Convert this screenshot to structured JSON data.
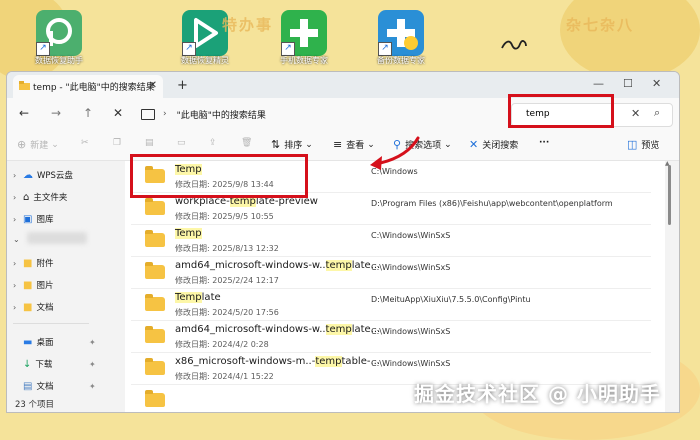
{
  "desktop": {
    "icons": [
      {
        "label": "数据恢复助手",
        "color": "#4caf6e"
      },
      {
        "label": "数据恢复精灵",
        "color": "#1ba178"
      },
      {
        "label": "手机数据专家",
        "color": "#2fb24c"
      },
      {
        "label": "备份数据专家",
        "color": "#2a8fd6"
      }
    ],
    "faded_texts": [
      "特办事",
      "杂七杂八"
    ]
  },
  "window": {
    "tab_title": "temp - \"此电脑\"中的搜索结果",
    "address_text": "\"此电脑\"中的搜索结果",
    "search_value": "temp",
    "toolbar": {
      "new": "新建",
      "sort": "排序",
      "view": "查看",
      "search_options": "搜索选项",
      "close_search": "关闭搜索",
      "more": "···",
      "preview": "预览"
    },
    "sidebar": {
      "items": [
        {
          "label": "WPS云盘",
          "icon": "cloud-icon"
        },
        {
          "label": "主文件夹",
          "icon": "home-icon"
        },
        {
          "label": "图库",
          "icon": "gallery-icon"
        },
        {
          "label": "附件",
          "icon": "folder-icon"
        },
        {
          "label": "图片",
          "icon": "folder-icon"
        },
        {
          "label": "文档",
          "icon": "folder-icon"
        },
        {
          "label": "桌面",
          "icon": "desktop-icon"
        },
        {
          "label": "下载",
          "icon": "download-icon"
        },
        {
          "label": "文档",
          "icon": "document-icon"
        }
      ]
    },
    "status_text": "23 个项目",
    "files": [
      {
        "name_pre": "",
        "name_hl": "Temp",
        "name_post": "",
        "date": "修改日期: 2025/9/8 13:44",
        "path": "C:\\Windows"
      },
      {
        "name_pre": "workplace-",
        "name_hl": "temp",
        "name_post": "late-preview",
        "date": "修改日期: 2025/9/5 10:55",
        "path": "D:\\Program Files (x86)\\Feishu\\app\\webcontent\\openplatform"
      },
      {
        "name_pre": "",
        "name_hl": "Temp",
        "name_post": "",
        "date": "修改日期: 2025/8/13 12:32",
        "path": "C:\\Windows\\WinSxS"
      },
      {
        "name_pre": "amd64_microsoft-windows-w..",
        "name_hl": "temp",
        "name_post": "late...",
        "date": "修改日期: 2025/2/24 12:17",
        "path": "C:\\Windows\\WinSxS"
      },
      {
        "name_pre": "",
        "name_hl": "Temp",
        "name_post": "late",
        "date": "修改日期: 2024/5/20 17:56",
        "path": "D:\\MeituApp\\XiuXiu\\7.5.5.0\\Config\\Pintu"
      },
      {
        "name_pre": "amd64_microsoft-windows-w..",
        "name_hl": "temp",
        "name_post": "late...",
        "date": "修改日期: 2024/4/2 0:28",
        "path": "C:\\Windows\\WinSxS"
      },
      {
        "name_pre": "x86_microsoft-windows-m..-",
        "name_hl": "temp",
        "name_post": "table-...",
        "date": "修改日期: 2024/4/1 15:22",
        "path": "C:\\Windows\\WinSxS"
      }
    ]
  },
  "watermark": "掘金技术社区 @ 小明助手",
  "colors": {
    "highlight": "#fdf7a8",
    "annotation_red": "#d5101b",
    "folder": "#f6c343"
  }
}
